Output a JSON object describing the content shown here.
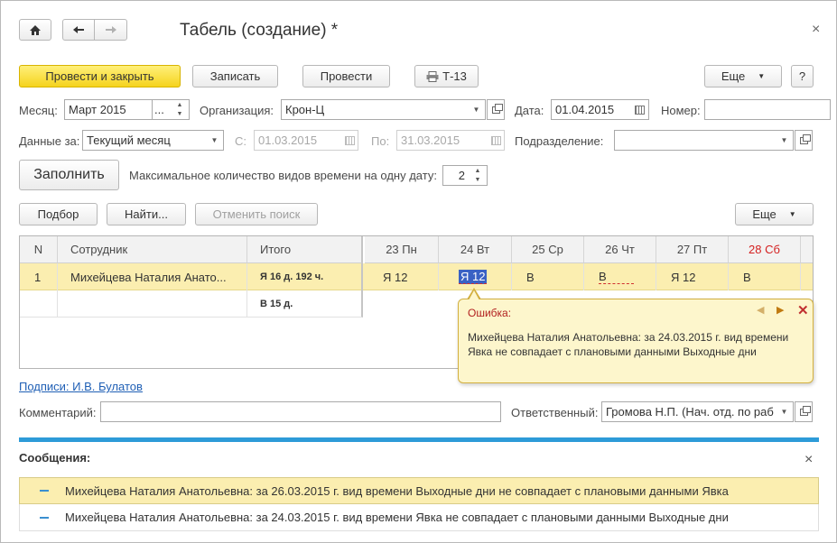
{
  "window": {
    "title": "Табель (создание) *",
    "close": "×"
  },
  "nav": {
    "home_icon": "home-icon",
    "back_icon": "arrow-left-icon",
    "forward_icon": "arrow-right-icon"
  },
  "toolbar": {
    "post_close": "Провести и закрыть",
    "save": "Записать",
    "post": "Провести",
    "print_t13": "Т-13",
    "more": "Еще",
    "help": "?"
  },
  "header": {
    "month_label": "Месяц:",
    "month_value": "Март 2015",
    "month_select": "...",
    "org_label": "Организация:",
    "org_value": "Крон-Ц",
    "date_label": "Дата:",
    "date_value": "01.04.2015",
    "number_label": "Номер:",
    "number_value": "",
    "data_for_label": "Данные за:",
    "data_for_value": "Текущий месяц",
    "from_label": "С:",
    "from_value": "01.03.2015",
    "to_label": "По:",
    "to_value": "31.03.2015",
    "division_label": "Подразделение:",
    "division_value": ""
  },
  "fill": {
    "button": "Заполнить",
    "max_kinds_label": "Максимальное количество видов времени на одну дату:",
    "max_kinds_value": "2"
  },
  "table_toolbar": {
    "pick": "Подбор",
    "find": "Найти...",
    "cancel_search": "Отменить поиск",
    "more": "Еще"
  },
  "table": {
    "headers": [
      "N",
      "Сотрудник",
      "Итого",
      "23 Пн",
      "24 Вт",
      "25 Ср",
      "26 Чт",
      "27 Пт",
      "28 Сб"
    ],
    "weekend_color": "#d42020",
    "rows": [
      {
        "n": "1",
        "employee": "Михейцева Наталия Анато...",
        "total": "Я 16 д. 192 ч.",
        "total2": "В 15 д.",
        "days": [
          "Я 12",
          "Я 12",
          "В",
          "В",
          "Я 12",
          "В"
        ]
      }
    ]
  },
  "error_tip": {
    "title": "Ошибка:",
    "text": "Михейцева Наталия Анатольевна: за 24.03.2015 г. вид времени Явка не совпадает с плановыми данными Выходные дни"
  },
  "footer": {
    "signatures": "Подписи: И.В. Булатов",
    "comment_label": "Комментарий:",
    "comment_value": "",
    "responsible_label": "Ответственный:",
    "responsible_value": "Громова Н.П. (Нач. отд. по раб"
  },
  "messages": {
    "title": "Сообщения:",
    "close": "×",
    "items": [
      "Михейцева Наталия Анатольевна: за 26.03.2015 г. вид времени Выходные дни не совпадает с плановыми данными Явка",
      "Михейцева Наталия Анатольевна: за 24.03.2015 г. вид времени Явка не совпадает с плановыми данными Выходные дни"
    ]
  }
}
